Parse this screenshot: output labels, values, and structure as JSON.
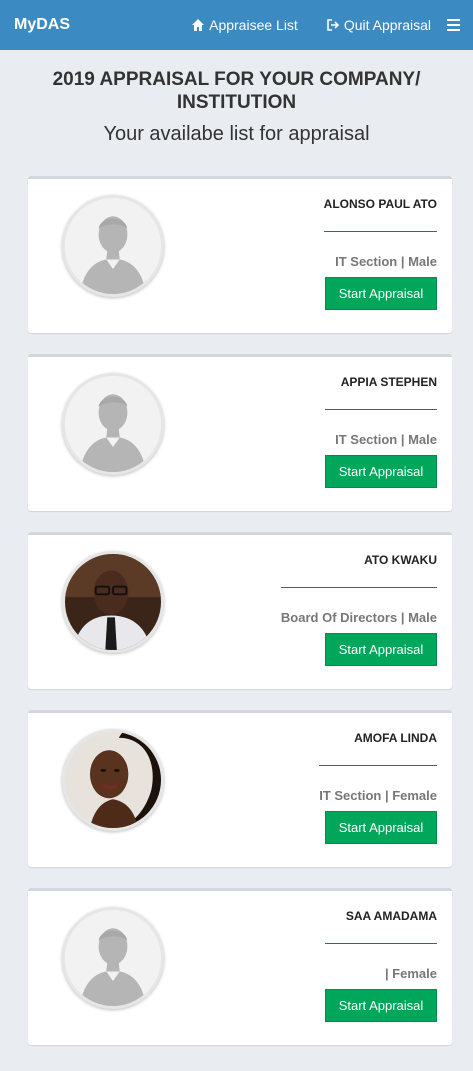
{
  "nav": {
    "brand": "MyDAS",
    "appraisee_list": "Appraisee List",
    "quit_appraisal": "Quit Appraisal"
  },
  "heading": {
    "title": "2019 APPRAISAL FOR YOUR COMPANY/ INSTITUTION",
    "subtitle": "Your availabe list for appraisal"
  },
  "appraisees": [
    {
      "name": "ALONSO PAUL ATO",
      "section": "IT Section",
      "gender": "Male",
      "avatar": "default",
      "button": "Start Appraisal"
    },
    {
      "name": "APPIA STEPHEN",
      "section": "IT Section",
      "gender": "Male",
      "avatar": "default",
      "button": "Start Appraisal"
    },
    {
      "name": "ATO KWAKU",
      "section": "Board Of Directors",
      "gender": "Male",
      "avatar": "photo-man",
      "button": "Start Appraisal"
    },
    {
      "name": "AMOFA LINDA",
      "section": "IT Section",
      "gender": "Female",
      "avatar": "photo-woman",
      "button": "Start Appraisal"
    },
    {
      "name": "SAA AMADAMA",
      "section": "",
      "gender": "Female",
      "avatar": "default",
      "button": "Start Appraisal"
    }
  ],
  "icons": {
    "home": "home-icon",
    "signout": "sign-out-icon",
    "menu": "hamburger-menu-icon"
  },
  "colors": {
    "navbar": "#3b8ac1",
    "button": "#00a65a",
    "background": "#e9ecf1"
  }
}
